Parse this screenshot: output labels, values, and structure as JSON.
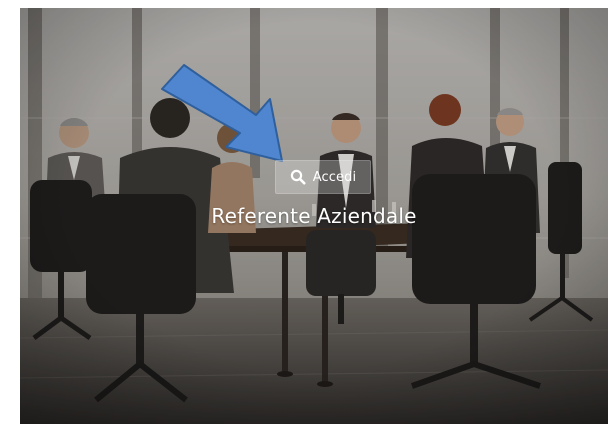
{
  "login": {
    "button_label": "Accedi",
    "icon": "search-icon"
  },
  "hero": {
    "title": "Referente Aziendale"
  },
  "colors": {
    "arrow_fill": "#4f86cf",
    "arrow_stroke": "#2f5f9c",
    "button_bg": "#e8e8e8",
    "text": "#ffffff"
  }
}
